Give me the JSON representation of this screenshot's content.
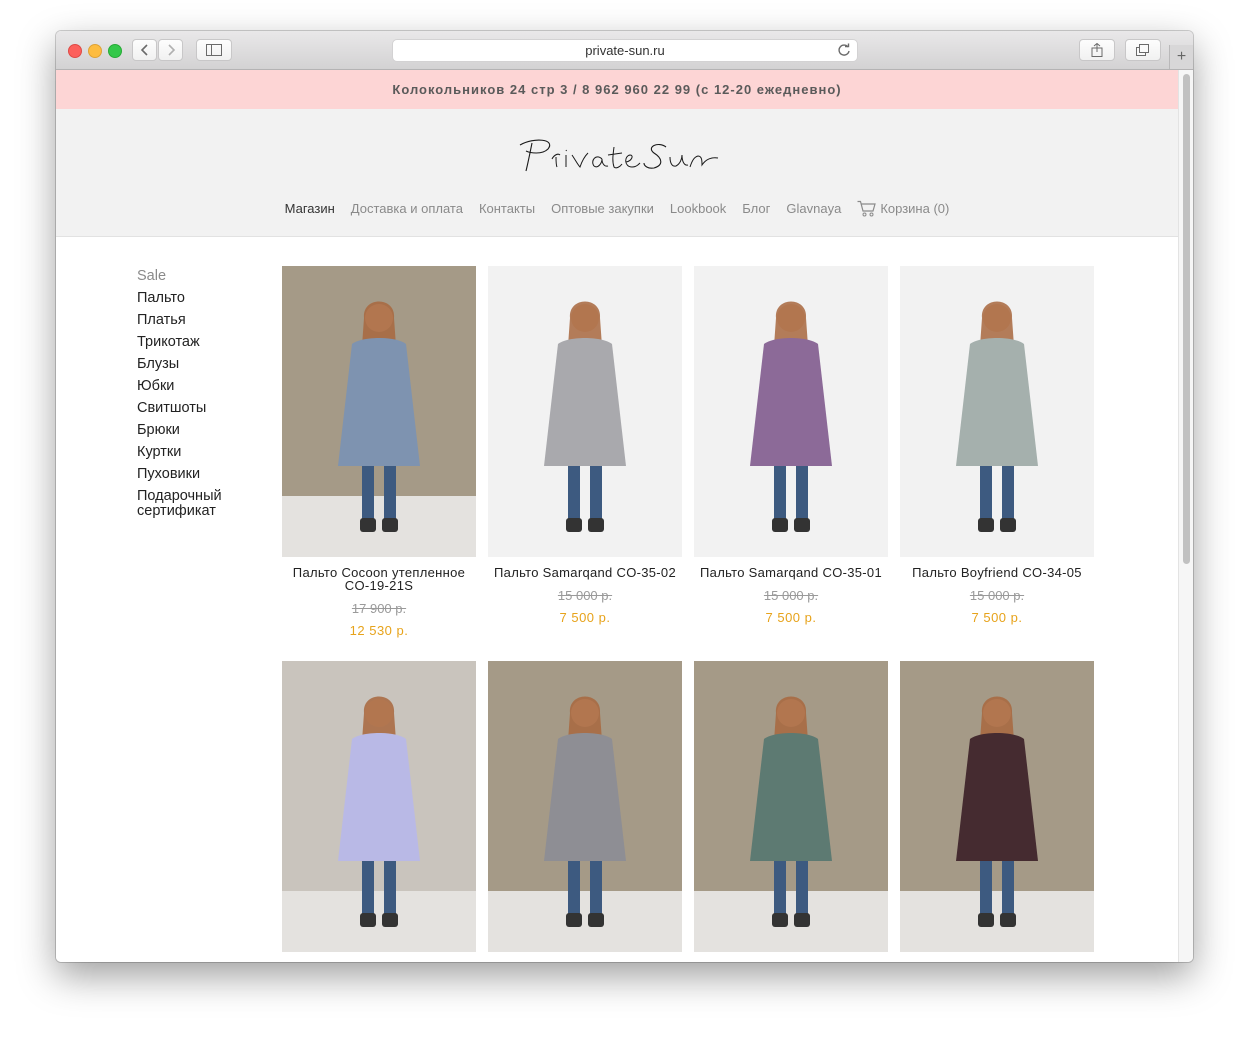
{
  "browser": {
    "url": "private-sun.ru",
    "new_tab_label": "+"
  },
  "site": {
    "top_bar": "Колокольников 24 стр 3 / 8 962 960 22 99 (с 12-20 ежедневно)",
    "logo_text": "Private Sun",
    "nav": [
      {
        "label": "Магазин",
        "active": true
      },
      {
        "label": "Доставка и оплата",
        "active": false
      },
      {
        "label": "Контакты",
        "active": false
      },
      {
        "label": "Оптовые закупки",
        "active": false
      },
      {
        "label": "Lookbook",
        "active": false
      },
      {
        "label": "Блог",
        "active": false
      },
      {
        "label": "Glavnaya",
        "active": false
      },
      {
        "label": "Корзина (0)",
        "active": false,
        "icon": "cart-icon"
      }
    ]
  },
  "sidebar": {
    "categories": [
      "Sale",
      "Пальто",
      "Платья",
      "Трикотаж",
      "Блузы",
      "Юбки",
      "Свитшоты",
      "Брюки",
      "Куртки",
      "Пуховики",
      "Подарочный сертификат"
    ]
  },
  "products": [
    {
      "name": "Пальто Cocoon утепленное CO-19-21S",
      "old_price": "17 900 р.",
      "price": "12 530 р.",
      "coat_color": "#7e93b0",
      "backdrop": "#a59a87"
    },
    {
      "name": "Пальто Samarqand CO-35-02",
      "old_price": "15 000 р.",
      "price": "7 500 р.",
      "coat_color": "#a9a9ad",
      "backdrop": "#f2f2f2"
    },
    {
      "name": "Пальто Samarqand CO-35-01",
      "old_price": "15 000 р.",
      "price": "7 500 р.",
      "coat_color": "#8c6a98",
      "backdrop": "#f2f2f2"
    },
    {
      "name": "Пальто Boyfriend CO-34-05",
      "old_price": "15 000 р.",
      "price": "7 500 р.",
      "coat_color": "#a5b0ad",
      "backdrop": "#f2f2f2"
    },
    {
      "name": "",
      "old_price": "",
      "price": "",
      "coat_color": "#b9b9e6",
      "backdrop": "#c9c4bd"
    },
    {
      "name": "",
      "old_price": "",
      "price": "",
      "coat_color": "#8e8e94",
      "backdrop": "#a59a87"
    },
    {
      "name": "",
      "old_price": "",
      "price": "",
      "coat_color": "#5d7a72",
      "backdrop": "#a59a87"
    },
    {
      "name": "",
      "old_price": "",
      "price": "",
      "coat_color": "#452b30",
      "backdrop": "#a59a87"
    }
  ]
}
